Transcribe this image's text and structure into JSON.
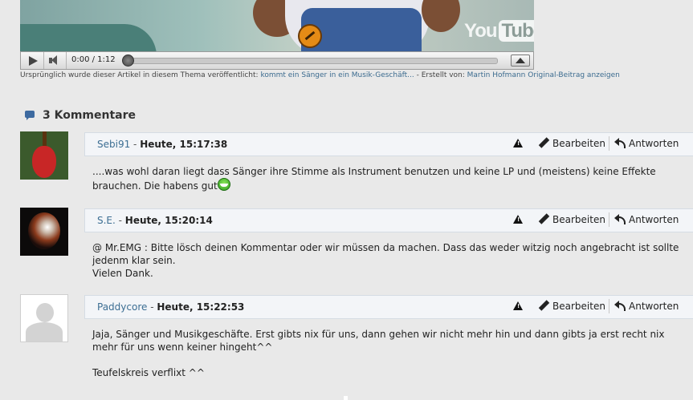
{
  "video": {
    "logo_left": "You",
    "logo_right": "Tube",
    "time": "0:00 / 1:12",
    "progress_fraction": 0.0
  },
  "source": {
    "prefix": "Ursprünglich wurde dieser Artikel in diesem Thema veröffentlicht: ",
    "thread_link": "kommt ein Sänger in ein Musik-Geschäft...",
    "created_by_label": " - Erstellt von: ",
    "author_link": "Martin Hofmann",
    "original_link": "Original-Beitrag anzeigen"
  },
  "comments_header": "3 Kommentare",
  "actions": {
    "edit": "Bearbeiten",
    "reply": "Antworten"
  },
  "comments": [
    {
      "author": "Sebi91",
      "separator": " - ",
      "date": "Heute, 15:17:38",
      "body": "....was wohl daran liegt dass Sänger ihre Stimme als Instrument benutzen und keine LP und (meistens) keine Effekte brauchen. Die habens gut"
    },
    {
      "author": "S.E.",
      "separator": " - ",
      "date": "Heute, 15:20:14",
      "body_line1": "@ Mr.EMG : Bitte lösch deinen Kommentar oder wir müssen da machen. Dass das weder witzig noch angebracht ist sollte jedenm klar sein.",
      "body_line2": "Vielen Dank."
    },
    {
      "author": "Paddycore",
      "separator": " - ",
      "date": "Heute, 15:22:53",
      "body_line1": "Jaja, Sänger und Musikgeschäfte. Erst gibts nix für uns, dann gehen wir nicht mehr hin und dann gibts ja erst recht nix mehr für uns wenn keiner hingeht^^",
      "body_line2": "Teufelskreis verflixt ^^"
    }
  ]
}
